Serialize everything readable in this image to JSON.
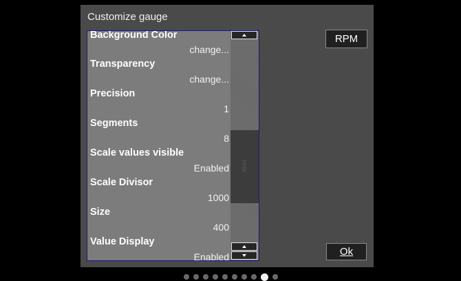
{
  "dialog": {
    "title": "Customize gauge",
    "settings": [
      {
        "label": "Background Color",
        "value": "change..."
      },
      {
        "label": "Transparency",
        "value": "change..."
      },
      {
        "label": "Precision",
        "value": "1"
      },
      {
        "label": "Segments",
        "value": "8"
      },
      {
        "label": "Scale values visible",
        "value": "Enabled"
      },
      {
        "label": "Scale Divisor",
        "value": "1000"
      },
      {
        "label": "Size",
        "value": "400"
      },
      {
        "label": "Value Display",
        "value": "Enabled"
      }
    ],
    "rpm_button": "RPM",
    "ok_button": "Ok"
  },
  "pager": {
    "total": 10,
    "active": 8
  }
}
